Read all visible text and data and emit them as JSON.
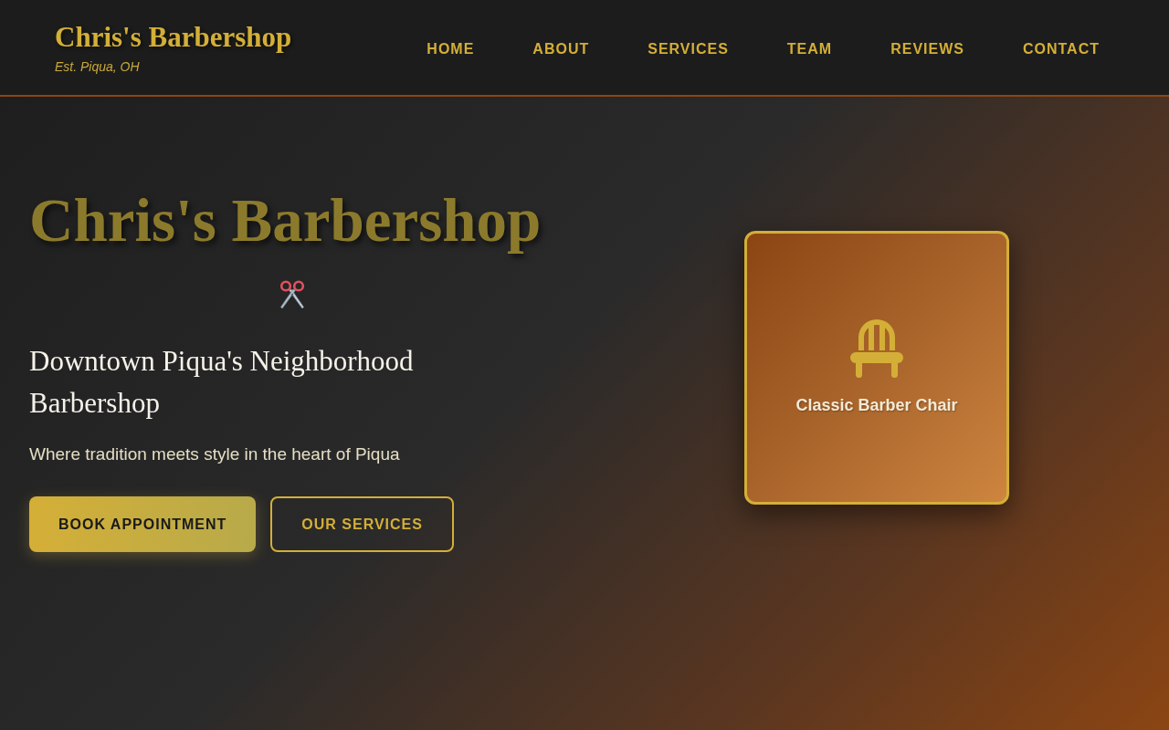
{
  "header": {
    "logo": "Chris's Barbershop",
    "tagline": "Est. Piqua, OH",
    "nav": [
      {
        "label": "HOME"
      },
      {
        "label": "ABOUT"
      },
      {
        "label": "SERVICES"
      },
      {
        "label": "TEAM"
      },
      {
        "label": "REVIEWS"
      },
      {
        "label": "CONTACT"
      }
    ]
  },
  "hero": {
    "title": "Chris's Barbershop",
    "subtitle": "Downtown Piqua's Neighborhood Barbershop",
    "description": "Where tradition meets style in the heart of Piqua",
    "buttons": [
      {
        "label": "BOOK APPOINTMENT",
        "kind": "primary"
      },
      {
        "label": "OUR SERVICES",
        "kind": "outline"
      }
    ],
    "feature_card": {
      "label": "Classic Barber Chair"
    }
  }
}
